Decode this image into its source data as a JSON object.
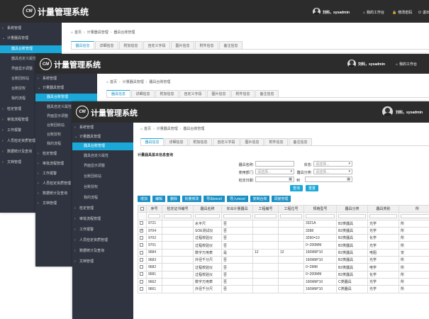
{
  "app": {
    "title": "计量管理系统",
    "logo_text": "CM"
  },
  "user": {
    "name": "刘科，sysadmin"
  },
  "top_links": [
    {
      "icon": "home-icon",
      "label": "我的工作台"
    },
    {
      "icon": "lock-icon",
      "label": "修改密码"
    },
    {
      "icon": "power-icon",
      "label": "退出"
    }
  ],
  "breadcrumb": [
    "首页",
    "计量器具管理",
    "器具台账管理"
  ],
  "tabs": [
    "器具信息",
    "详细信息",
    "附加信息",
    "自定义字段",
    "图片信息",
    "附件信息",
    "备注信息"
  ],
  "sidebar": [
    {
      "label": "系统管理",
      "level": 0
    },
    {
      "label": "计量器具管理",
      "level": 0
    },
    {
      "label": "器具台账管理",
      "level": 1,
      "active": true
    },
    {
      "label": "器具自定义属性",
      "level": 1
    },
    {
      "label": "界面显示调整",
      "level": 1
    },
    {
      "label": "台账回收站",
      "level": 1
    },
    {
      "label": "台账授权",
      "level": 1
    },
    {
      "label": "我的流程",
      "level": 1
    },
    {
      "label": "检定管理",
      "level": 0
    },
    {
      "label": "审批流程管理",
      "level": 0
    },
    {
      "label": "工作报警",
      "level": 0
    },
    {
      "label": "人员检定资质管理",
      "level": 0
    },
    {
      "label": "数据统计及查询",
      "level": 0
    },
    {
      "label": "文档管理",
      "level": 0
    }
  ],
  "query": {
    "title": "计量器具基本信息查询",
    "fields": [
      {
        "label": "器具名称:",
        "value": ""
      },
      {
        "label": "状态:",
        "value": "请选择..."
      },
      {
        "label": "使用部门:",
        "value": "请选择..."
      },
      {
        "label": "器具分类:",
        "value": "请选择..."
      },
      {
        "label": "检定日期:",
        "value": ""
      },
      {
        "label": "到",
        "value": ""
      }
    ],
    "search_label": "查询",
    "reset_label": "重置"
  },
  "toolbar": [
    "增加",
    "编辑",
    "删除",
    "批量修改",
    "导出excel",
    "导入excel",
    "复制台账",
    "调度管理"
  ],
  "table": {
    "columns": [
      "序号",
      "检定证书编号",
      "器具名称",
      "实出计量器具",
      "工程编号",
      "工程位号",
      "规格型号",
      "器具分类",
      "器具类别",
      "所"
    ],
    "rows": [
      {
        "checked": false,
        "cells": [
          "9721",
          "",
          "水平尺",
          "否",
          "",
          "",
          "3321A",
          "B2类器具",
          "光学",
          "所"
        ]
      },
      {
        "checked": true,
        "cells": [
          "9704",
          "",
          "SOE测试仪",
          "否",
          "",
          "",
          "3288",
          "B2类器具",
          "光学",
          "所"
        ]
      },
      {
        "checked": false,
        "cells": [
          "9702",
          "",
          "过程校验仪",
          "否",
          "",
          "",
          "3290=10",
          "B2类器具",
          "化学",
          "所"
        ]
      },
      {
        "checked": false,
        "cells": [
          "9701",
          "",
          "过程校验仪",
          "否",
          "",
          "",
          "0~200MM",
          "B2类器具",
          "光学",
          "所"
        ]
      },
      {
        "checked": false,
        "cells": [
          "9684",
          "",
          "数字万用表",
          "是",
          "12",
          "12",
          "160MM*10",
          "B2类器具",
          "电阻",
          "安"
        ]
      },
      {
        "checked": false,
        "cells": [
          "9683",
          "",
          "外径千分尺",
          "否",
          "",
          "",
          "160MM*10",
          "B2类器具",
          "光学",
          "所"
        ]
      },
      {
        "checked": false,
        "cells": [
          "9682",
          "",
          "过程校验仪",
          "否",
          "",
          "",
          "0~2MM",
          "B2类器具",
          "电学",
          "所"
        ]
      },
      {
        "checked": false,
        "cells": [
          "9681",
          "",
          "过程校验仪",
          "否",
          "",
          "",
          "0~200MM",
          "B2类器具",
          "化学",
          "所"
        ]
      },
      {
        "checked": false,
        "cells": [
          "9662",
          "",
          "数字万用表",
          "否",
          "",
          "",
          "160MM*10",
          "C类器具",
          "光学",
          "所"
        ]
      },
      {
        "checked": false,
        "cells": [
          "9661",
          "",
          "外径千分尺",
          "否",
          "",
          "",
          "160MM*10",
          "C类器具",
          "光学",
          "所"
        ]
      }
    ]
  },
  "colors": {
    "topbar": "#2c2c2c",
    "sidebar": "#2f3440",
    "accent": "#1ba8d8",
    "toolbar": "#1a8fc4"
  }
}
